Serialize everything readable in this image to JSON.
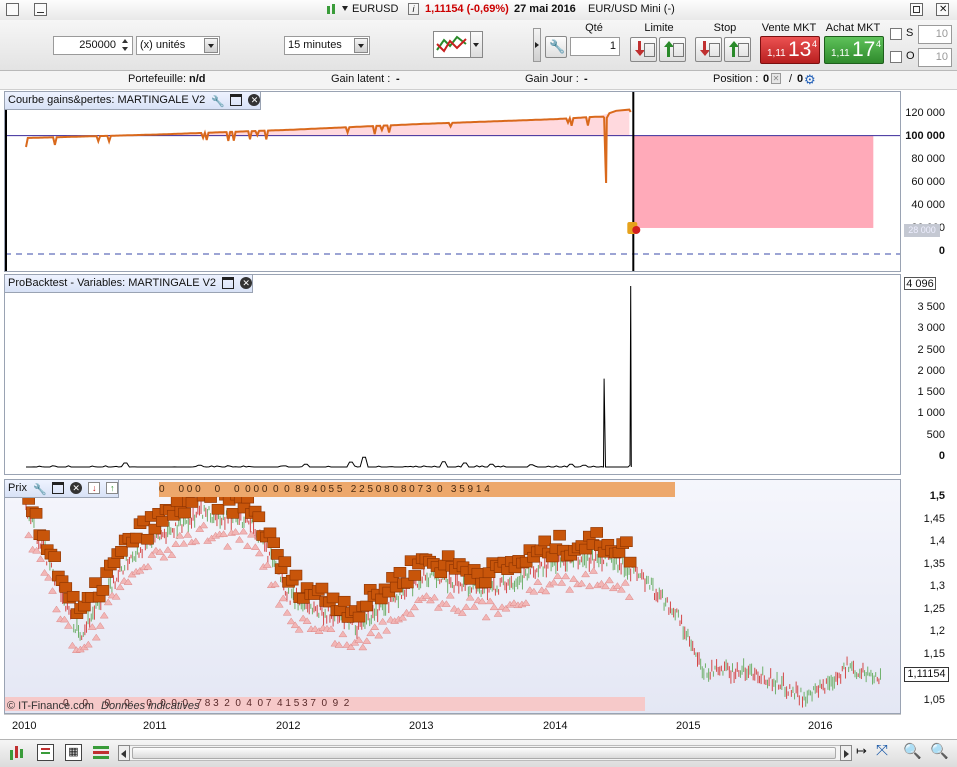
{
  "window": {
    "symbol": "EURUSD",
    "price_change": "1,11154 (-0,69%)",
    "date": "27 mai 2016",
    "instrument_name": "EUR/USD Mini (-)"
  },
  "order_bar": {
    "quantity_value": "250000",
    "unit_select": "(x) unités",
    "timeframe_select": "15 minutes",
    "qty_label": "Qté",
    "qty_value": "1",
    "limit_label": "Limite",
    "stop_label": "Stop",
    "sell_label": "Vente MKT",
    "buy_label": "Achat MKT",
    "sell_price_small": "1,11",
    "sell_price_big": "13",
    "sell_price_sup": "4",
    "buy_price_small": "1,11",
    "buy_price_big": "17",
    "buy_price_sup": "4",
    "s_label": "S",
    "o_label": "O",
    "s_value": "10",
    "o_value": "10"
  },
  "info_bar": {
    "portfolio_label": "Portefeuille:",
    "portfolio_value": "n/d",
    "latent_label": "Gain latent :",
    "latent_value": "-",
    "day_label": "Gain Jour :",
    "day_value": "-",
    "position_label": "Position :",
    "position_value_1": "0",
    "position_sep": "/",
    "position_value_2": "0"
  },
  "panel1": {
    "title": "Courbe gains&pertes: MARTINGALE V2",
    "y_ticks": [
      "120 000",
      "100 000",
      "80 000",
      "60 000",
      "40 000",
      "20 000",
      "0"
    ],
    "marker_label": "28 000"
  },
  "panel2": {
    "title": "ProBacktest - Variables: MARTINGALE V2",
    "y_ticks": [
      "4 096",
      "3 500",
      "3 000",
      "2 500",
      "2 000",
      "1 500",
      "1 000",
      "500",
      "0"
    ]
  },
  "panel3": {
    "title": "Prix",
    "y_ticks": [
      "1,5",
      "1,45",
      "1,4",
      "1,35",
      "1,3",
      "1,25",
      "1,2",
      "1,15",
      "1,1",
      "1,05"
    ],
    "current_price": "1,11154",
    "watermark": "© IT-Finance.com",
    "watermark_note": "Données indicatives",
    "top_strip": "0     0 0 0     0     0  0 0 0  0  0  8 9 4 0 5 5   2 2 5 0 8 0 8 0 7 3  0   3 5 9 1 4",
    "bottom_strip": "0     0      0     0      0   0  0  0   7 8 3  2  0  4  0 7  4 1 5 3 7  0  9  2"
  },
  "x_axis": {
    "labels": [
      "2010",
      "2011",
      "2012",
      "2013",
      "2014",
      "2015",
      "2016"
    ]
  },
  "colors": {
    "equity_line": "#d9691c",
    "profit_fill": "#ffd9de",
    "drawdown_fill": "#ffaab9",
    "price_up": "#6fb06b",
    "price_down": "#d44848",
    "order_box": "#c8550a",
    "sell_bg": "#d43434",
    "buy_bg": "#3fa43c"
  },
  "chart_data": [
    {
      "type": "line",
      "title": "Courbe gains&pertes: MARTINGALE V2",
      "x": [
        "2010",
        "2010.5",
        "2011",
        "2011.5",
        "2012",
        "2012.5",
        "2013",
        "2013.5",
        "2014",
        "2014.3",
        "2014.38",
        "2014.4",
        "2014.45",
        "2014.55",
        "2014.58"
      ],
      "values": [
        98000,
        99500,
        101000,
        103000,
        105000,
        107500,
        110000,
        112000,
        114000,
        116000,
        60000,
        119000,
        121000,
        122000,
        22000
      ],
      "reference_line": 100000,
      "ylim": [
        -5000,
        130000
      ]
    },
    {
      "type": "line",
      "title": "ProBacktest - Variables: MARTINGALE V2",
      "x": [
        "2010",
        "2011",
        "2012",
        "2012.5",
        "2013",
        "2013.5",
        "2014",
        "2014.36",
        "2014.4",
        "2014.56",
        "2014.58"
      ],
      "values": [
        0,
        60,
        30,
        200,
        100,
        80,
        120,
        2000,
        0,
        4096,
        0
      ],
      "ylim": [
        0,
        4200
      ]
    },
    {
      "type": "line",
      "title": "Prix",
      "x": [
        "2010",
        "2010.4",
        "2010.8",
        "2011.3",
        "2011.7",
        "2012",
        "2012.5",
        "2013",
        "2013.5",
        "2014",
        "2014.4",
        "2014.6",
        "2014.9",
        "2015.1",
        "2015.5",
        "2015.9",
        "2016.2",
        "2016.4"
      ],
      "values": [
        1.48,
        1.2,
        1.38,
        1.47,
        1.45,
        1.28,
        1.22,
        1.33,
        1.3,
        1.36,
        1.37,
        1.34,
        1.25,
        1.12,
        1.12,
        1.06,
        1.13,
        1.11154
      ],
      "ylim": [
        1.03,
        1.52
      ]
    }
  ]
}
